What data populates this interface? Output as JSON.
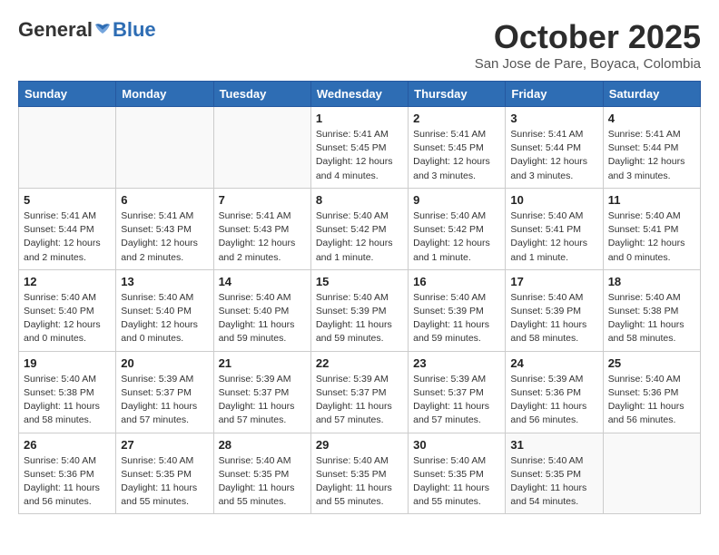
{
  "header": {
    "logo_general": "General",
    "logo_blue": "Blue",
    "month": "October 2025",
    "location": "San Jose de Pare, Boyaca, Colombia"
  },
  "days_of_week": [
    "Sunday",
    "Monday",
    "Tuesday",
    "Wednesday",
    "Thursday",
    "Friday",
    "Saturday"
  ],
  "weeks": [
    [
      {
        "day": "",
        "info": ""
      },
      {
        "day": "",
        "info": ""
      },
      {
        "day": "",
        "info": ""
      },
      {
        "day": "1",
        "info": "Sunrise: 5:41 AM\nSunset: 5:45 PM\nDaylight: 12 hours\nand 4 minutes."
      },
      {
        "day": "2",
        "info": "Sunrise: 5:41 AM\nSunset: 5:45 PM\nDaylight: 12 hours\nand 3 minutes."
      },
      {
        "day": "3",
        "info": "Sunrise: 5:41 AM\nSunset: 5:44 PM\nDaylight: 12 hours\nand 3 minutes."
      },
      {
        "day": "4",
        "info": "Sunrise: 5:41 AM\nSunset: 5:44 PM\nDaylight: 12 hours\nand 3 minutes."
      }
    ],
    [
      {
        "day": "5",
        "info": "Sunrise: 5:41 AM\nSunset: 5:44 PM\nDaylight: 12 hours\nand 2 minutes."
      },
      {
        "day": "6",
        "info": "Sunrise: 5:41 AM\nSunset: 5:43 PM\nDaylight: 12 hours\nand 2 minutes."
      },
      {
        "day": "7",
        "info": "Sunrise: 5:41 AM\nSunset: 5:43 PM\nDaylight: 12 hours\nand 2 minutes."
      },
      {
        "day": "8",
        "info": "Sunrise: 5:40 AM\nSunset: 5:42 PM\nDaylight: 12 hours\nand 1 minute."
      },
      {
        "day": "9",
        "info": "Sunrise: 5:40 AM\nSunset: 5:42 PM\nDaylight: 12 hours\nand 1 minute."
      },
      {
        "day": "10",
        "info": "Sunrise: 5:40 AM\nSunset: 5:41 PM\nDaylight: 12 hours\nand 1 minute."
      },
      {
        "day": "11",
        "info": "Sunrise: 5:40 AM\nSunset: 5:41 PM\nDaylight: 12 hours\nand 0 minutes."
      }
    ],
    [
      {
        "day": "12",
        "info": "Sunrise: 5:40 AM\nSunset: 5:40 PM\nDaylight: 12 hours\nand 0 minutes."
      },
      {
        "day": "13",
        "info": "Sunrise: 5:40 AM\nSunset: 5:40 PM\nDaylight: 12 hours\nand 0 minutes."
      },
      {
        "day": "14",
        "info": "Sunrise: 5:40 AM\nSunset: 5:40 PM\nDaylight: 11 hours\nand 59 minutes."
      },
      {
        "day": "15",
        "info": "Sunrise: 5:40 AM\nSunset: 5:39 PM\nDaylight: 11 hours\nand 59 minutes."
      },
      {
        "day": "16",
        "info": "Sunrise: 5:40 AM\nSunset: 5:39 PM\nDaylight: 11 hours\nand 59 minutes."
      },
      {
        "day": "17",
        "info": "Sunrise: 5:40 AM\nSunset: 5:39 PM\nDaylight: 11 hours\nand 58 minutes."
      },
      {
        "day": "18",
        "info": "Sunrise: 5:40 AM\nSunset: 5:38 PM\nDaylight: 11 hours\nand 58 minutes."
      }
    ],
    [
      {
        "day": "19",
        "info": "Sunrise: 5:40 AM\nSunset: 5:38 PM\nDaylight: 11 hours\nand 58 minutes."
      },
      {
        "day": "20",
        "info": "Sunrise: 5:39 AM\nSunset: 5:37 PM\nDaylight: 11 hours\nand 57 minutes."
      },
      {
        "day": "21",
        "info": "Sunrise: 5:39 AM\nSunset: 5:37 PM\nDaylight: 11 hours\nand 57 minutes."
      },
      {
        "day": "22",
        "info": "Sunrise: 5:39 AM\nSunset: 5:37 PM\nDaylight: 11 hours\nand 57 minutes."
      },
      {
        "day": "23",
        "info": "Sunrise: 5:39 AM\nSunset: 5:37 PM\nDaylight: 11 hours\nand 57 minutes."
      },
      {
        "day": "24",
        "info": "Sunrise: 5:39 AM\nSunset: 5:36 PM\nDaylight: 11 hours\nand 56 minutes."
      },
      {
        "day": "25",
        "info": "Sunrise: 5:40 AM\nSunset: 5:36 PM\nDaylight: 11 hours\nand 56 minutes."
      }
    ],
    [
      {
        "day": "26",
        "info": "Sunrise: 5:40 AM\nSunset: 5:36 PM\nDaylight: 11 hours\nand 56 minutes."
      },
      {
        "day": "27",
        "info": "Sunrise: 5:40 AM\nSunset: 5:35 PM\nDaylight: 11 hours\nand 55 minutes."
      },
      {
        "day": "28",
        "info": "Sunrise: 5:40 AM\nSunset: 5:35 PM\nDaylight: 11 hours\nand 55 minutes."
      },
      {
        "day": "29",
        "info": "Sunrise: 5:40 AM\nSunset: 5:35 PM\nDaylight: 11 hours\nand 55 minutes."
      },
      {
        "day": "30",
        "info": "Sunrise: 5:40 AM\nSunset: 5:35 PM\nDaylight: 11 hours\nand 55 minutes."
      },
      {
        "day": "31",
        "info": "Sunrise: 5:40 AM\nSunset: 5:35 PM\nDaylight: 11 hours\nand 54 minutes."
      },
      {
        "day": "",
        "info": ""
      }
    ]
  ]
}
